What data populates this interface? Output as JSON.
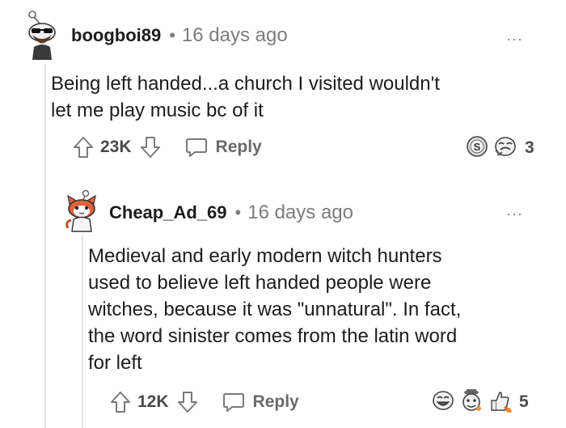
{
  "comments": [
    {
      "username": "boogboi89",
      "separator": "•",
      "timestamp": "16 days ago",
      "more_label": "···",
      "body_lines": [
        "Being left handed...a church I visited wouldn't",
        "let me play music bc of it"
      ],
      "vote_count": "23K",
      "reply_label": "Reply",
      "award_count": "3",
      "avatar_icon": "snoo-sunglasses-beard-avatar",
      "award_icons": [
        "silver-award-icon",
        "crying-award-icon"
      ]
    },
    {
      "username": "Cheap_Ad_69",
      "separator": "•",
      "timestamp": "16 days ago",
      "more_label": "···",
      "body_lines": [
        "Medieval and early modern witch hunters",
        "used to believe left handed people were",
        "witches, because it was \"unnatural\". In fact,",
        "the word sinister comes from the latin word",
        "for left"
      ],
      "vote_count": "12K",
      "reply_label": "Reply",
      "award_count": "5",
      "avatar_icon": "snoo-red-panda-avatar",
      "award_icons": [
        "laughing-award-icon",
        "wholesome-award-icon",
        "rocket-like-award-icon"
      ]
    }
  ],
  "colors": {
    "text": "#1c1c1c",
    "meta": "#7c7c7c",
    "thread_line": "#e6e6e6",
    "action": "#6f6f6f"
  }
}
